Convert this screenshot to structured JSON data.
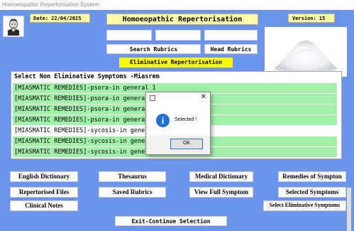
{
  "window": {
    "title": "Homoeopathic Repertorisation System"
  },
  "header": {
    "date": "Date: 22/04/2025",
    "app_title": "Homoeopathic Repertorisation",
    "version": "Version: 15"
  },
  "icons": {
    "portrait": "portrait-icon",
    "powder": "powder-image",
    "info": "info-icon",
    "close": "close-icon"
  },
  "search": {
    "search_rubrics_label": "Search Rubrics",
    "head_rubrics_label": "Head Rubrics",
    "eliminative_label": "Eliminative Repertorisation"
  },
  "list": {
    "header": "Select Non Eliminative Symptoms -Miasrem",
    "rows": [
      {
        "text": "[MIASMATIC REMEDIES]-psora-in general 1",
        "highlight": true
      },
      {
        "text": "[MIASMATIC REMEDIES]-psora-in general 2",
        "highlight": true
      },
      {
        "text": "[MIASMATIC REMEDIES]-psora-in general 3",
        "highlight": true
      },
      {
        "text": "[MIASMATIC REMEDIES]-psora-in general 4",
        "highlight": true
      },
      {
        "text": "[MIASMATIC REMEDIES]-sycosis-in general",
        "highlight": false
      },
      {
        "text": "[MIASMATIC REMEDIES]-sycosis-in general 2",
        "highlight": true
      },
      {
        "text": "[MIASMATIC REMEDIES]-sycosis-in general 3",
        "highlight": true
      }
    ]
  },
  "buttons": {
    "english_dictionary": "English Dictionary",
    "thesaurus": "Thesaurus",
    "medical_dictionary": "Medical Dictionary",
    "remedies_of_symptom": "Remedies of Sympton",
    "repertorised_files": "Repertorised Files",
    "saved_rubrics": "Saved Rubrics",
    "view_full_symptom": "View Full Symptom",
    "selected_symptoms": "Selected Symptoms",
    "clinical_notes": "Clinical Notes",
    "select_eliminative_symptoms": "Select Eliminative Symptoms",
    "exit_continue": "Exit-Continue Selection"
  },
  "dialog": {
    "message": "Selected !",
    "ok_label": "OK",
    "close_glyph": "✕",
    "info_glyph": "i"
  },
  "colors": {
    "background": "#6b95ec",
    "label_yellow": "#fffba8",
    "eliminative_yellow": "#fffb00",
    "row_green": "#a3f0a9",
    "info_blue": "#1e6fd6"
  }
}
